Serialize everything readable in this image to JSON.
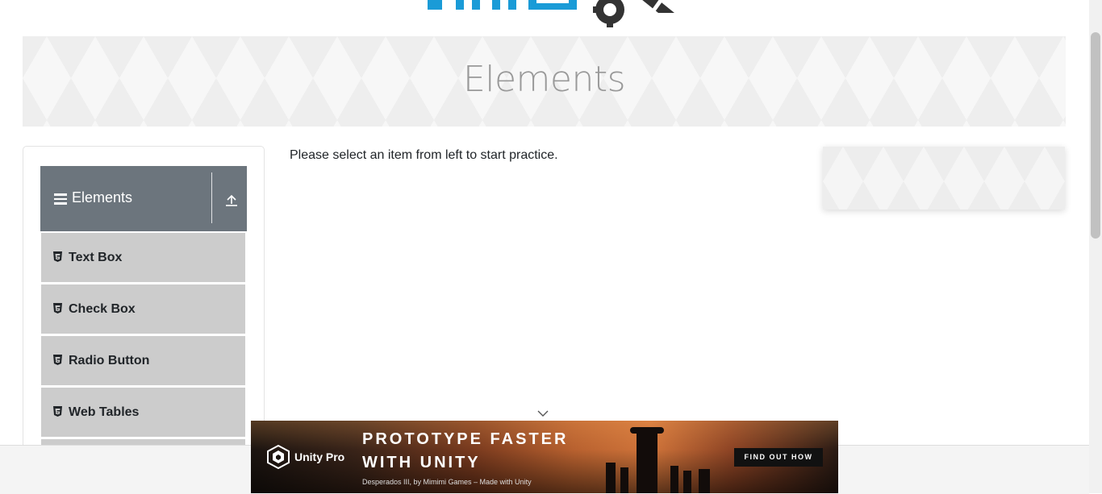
{
  "banner": {
    "title": "Elements"
  },
  "sidebar": {
    "group_title": "Elements",
    "items": [
      {
        "label": "Text Box"
      },
      {
        "label": "Check Box"
      },
      {
        "label": "Radio Button"
      },
      {
        "label": "Web Tables"
      }
    ]
  },
  "main": {
    "instruction": "Please select an item from left to start practice."
  },
  "ad": {
    "brand": "Unity Pro",
    "headline_line1": "PROTOTYPE FASTER",
    "headline_line2": "WITH UNITY",
    "subtitle": "Desperados III, by Mimimi Games – Made with Unity",
    "cta": "FIND OUT HOW"
  },
  "colors": {
    "sidebar_header": "#6c757d",
    "menu_item": "#cccccc",
    "logo_blue": "#1a9bd7",
    "logo_dark": "#333333"
  }
}
